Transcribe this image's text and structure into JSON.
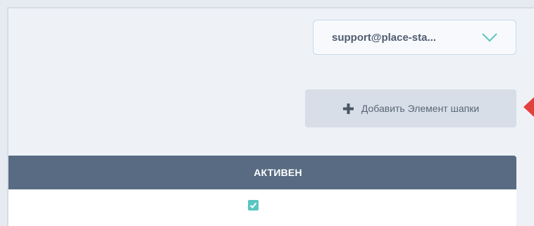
{
  "header": {
    "user_menu": {
      "label": "support@place-sta...",
      "icon": "chevron-down-icon",
      "accent_color": "#5bc5c2"
    }
  },
  "toolbar": {
    "add_button": {
      "icon": "plus-icon",
      "label": "Добавить Элемент шапки"
    }
  },
  "table": {
    "columns": [
      "АКТИВЕН"
    ],
    "header_color": "#586b82",
    "rows": [
      {
        "active": true
      }
    ]
  },
  "annotation": {
    "icon": "red-arrow-icon",
    "color": "#e2403f"
  }
}
